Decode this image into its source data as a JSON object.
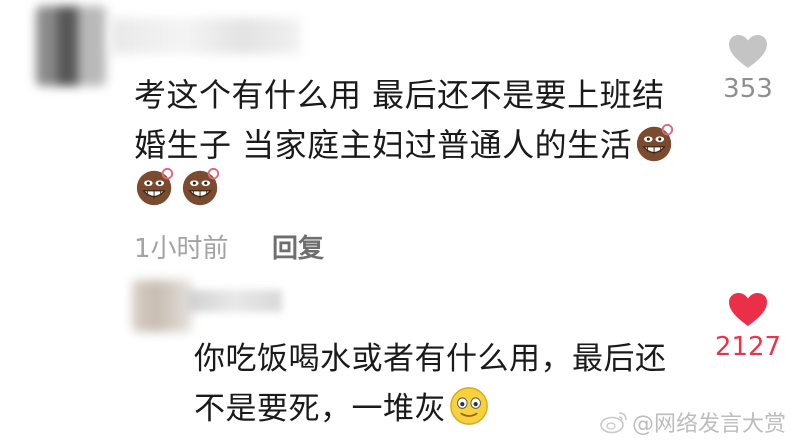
{
  "comment1": {
    "lines": [
      "考这个有什么用 最后还不是要上班结",
      "婚生子 当家庭主妇过普通人的生活"
    ],
    "like_count": "353",
    "time": "1小时前",
    "reply_label": "回复"
  },
  "comment2": {
    "lines": [
      "你吃饭喝水或者有什么用，最后还",
      "不是要死，一堆灰"
    ],
    "like_count": "2127"
  },
  "watermark": "@网络发言大赏",
  "colors": {
    "liked": "#e9344b",
    "unliked": "#bfbfbf",
    "muted_text": "#a3a3a3"
  },
  "icons": [
    "heart-outline-icon",
    "heart-filled-icon",
    "doge-grin-emoji",
    "smile-emoji",
    "weibo-logo-icon"
  ]
}
